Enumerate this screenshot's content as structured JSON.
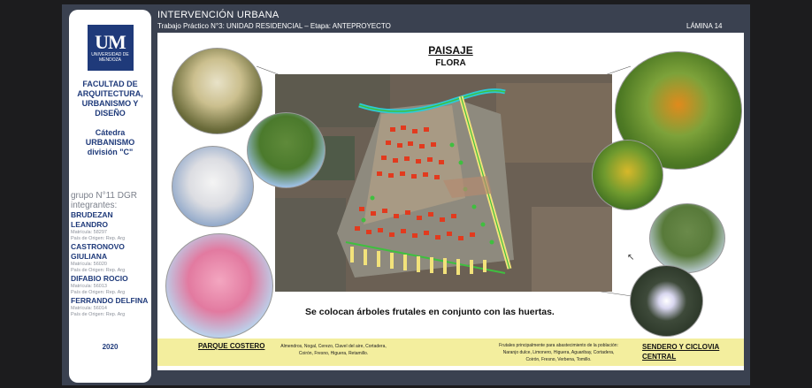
{
  "sidebar": {
    "logo_text": "UM",
    "logo_sub": "UNIVERSIDAD DE MENDOZA",
    "faculty_lines": [
      "FACULTAD DE",
      "ARQUITECTURA,",
      "URBANISMO Y",
      "DISEÑO"
    ],
    "catedra_lines": [
      "Cátedra",
      "URBANISMO",
      "división \"C\""
    ],
    "group_lines": [
      "grupo N°11 DGR",
      "integrantes:"
    ],
    "members": [
      {
        "name": "BRUDEZAN LEANDRO",
        "matricula": "Matrícula: 58297",
        "origen": "País de Origen: Rep. Arg"
      },
      {
        "name": "CASTRONOVO GIULIANA",
        "matricula": "Matrícula: 56020",
        "origen": "País de Origen: Rep. Arg"
      },
      {
        "name": "DIFABIO ROCIO",
        "matricula": "Matrícula: 56013",
        "origen": "País de Origen: Rep. Arg"
      },
      {
        "name": "FERRANDO DELFINA",
        "matricula": "Matrícula: 56014",
        "origen": "País de Origen: Rep. Arg"
      }
    ],
    "year": "2020"
  },
  "header": {
    "title": "INTERVENCIÓN URBANA",
    "subtitle": "Trabajo Práctico N°3: UNIDAD RESIDENCIAL – Etapa: ANTEPROYECTO",
    "lamina": "LÁMINA 14"
  },
  "slide": {
    "title": "PAISAJE",
    "subtitle": "FLORA",
    "caption": "Se colocan árboles frutales en conjunto con las huertas."
  },
  "footer": {
    "park_label": "PARQUE COSTERO",
    "park_list": [
      "Almendros, Nogal, Cerezo, Clavel del aire, Cortadera,",
      "Coirón, Fresno, Higuera, Retamillo."
    ],
    "fruit_list": [
      "Frutales principalmente para abastecimiento de la población:",
      "Naranjo dulce, Limonero, Higuera, Aguaribay, Cortadera,",
      "Coirón, Fresno, Verbena, Tomillo."
    ],
    "sendero_lines": [
      "SENDERO Y CICLOVIA",
      "CENTRAL"
    ]
  },
  "colors": {
    "brand_blue": "#1f3a7a",
    "footer_yellow": "#f3ee9e",
    "plan_red": "#e23a1e",
    "plan_green": "#3fbf3f",
    "river_cyan": "#2ec9d6"
  }
}
